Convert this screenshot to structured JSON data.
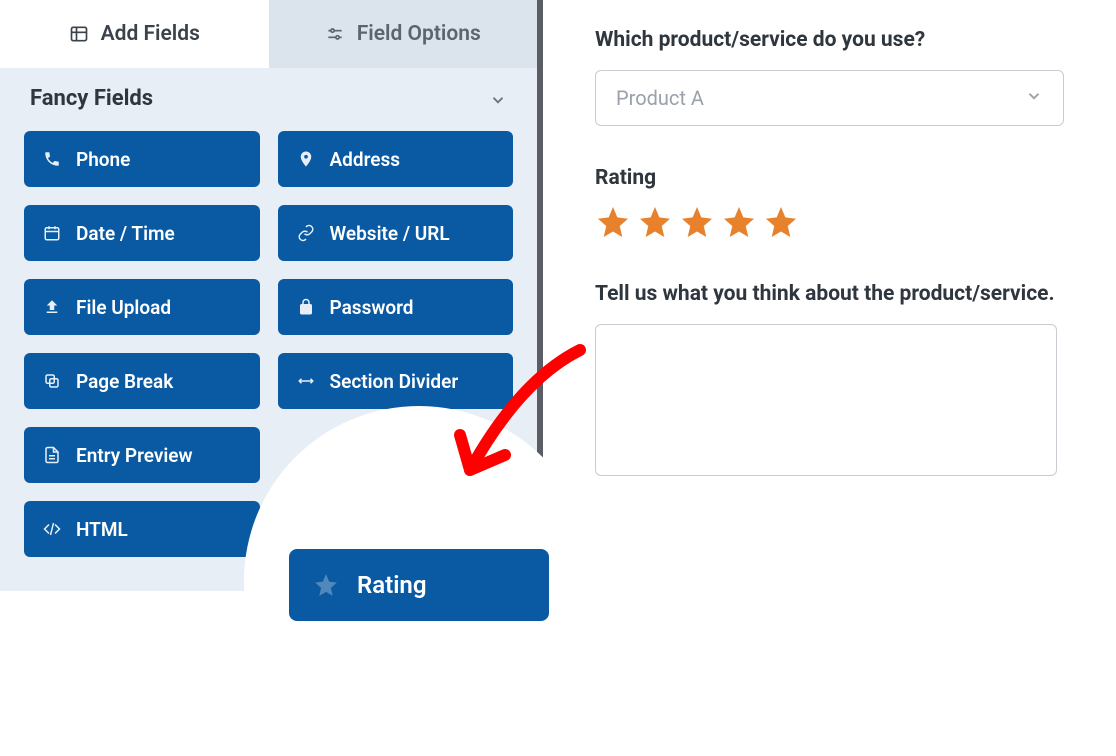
{
  "tabs": {
    "add": "Add Fields",
    "options": "Field Options"
  },
  "section_title": "Fancy Fields",
  "fields": {
    "phone": "Phone",
    "address": "Address",
    "datetime": "Date / Time",
    "website": "Website / URL",
    "upload": "File Upload",
    "password": "Password",
    "pagebreak": "Page Break",
    "section": "Section Divider",
    "entry": "Entry Preview",
    "html": "HTML",
    "rating": "Rating"
  },
  "preview": {
    "q1_label": "Which product/service do you use?",
    "q1_value": "Product A",
    "q2_label": "Rating",
    "q3_label": "Tell us what you think about the product/service."
  },
  "highlight_label": "Rating",
  "rating_value": 5
}
